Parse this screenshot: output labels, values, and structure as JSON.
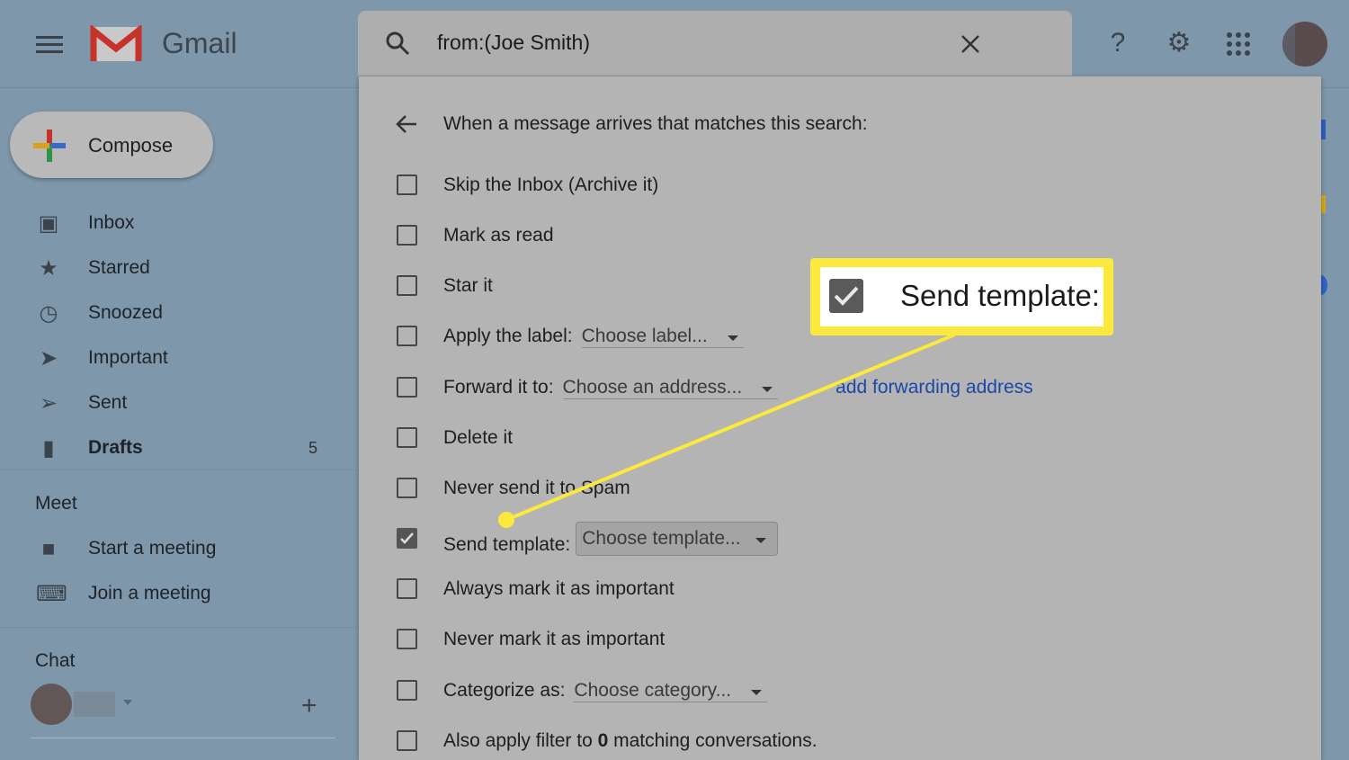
{
  "header": {
    "app_name": "Gmail",
    "search_query": "from:(Joe Smith)"
  },
  "sidebar": {
    "compose_label": "Compose",
    "items": [
      {
        "label": "Inbox",
        "icon": "inbox-icon"
      },
      {
        "label": "Starred",
        "icon": "star-icon"
      },
      {
        "label": "Snoozed",
        "icon": "clock-icon"
      },
      {
        "label": "Important",
        "icon": "important-icon"
      },
      {
        "label": "Sent",
        "icon": "send-icon"
      },
      {
        "label": "Drafts",
        "icon": "draft-icon",
        "count": "5"
      }
    ],
    "meet": {
      "title": "Meet",
      "items": [
        {
          "label": "Start a meeting"
        },
        {
          "label": "Join a meeting"
        }
      ]
    },
    "chat": {
      "title": "Chat"
    }
  },
  "filter": {
    "heading": "When a message arrives that matches this search:",
    "options": [
      {
        "label": "Skip the Inbox (Archive it)",
        "checked": false
      },
      {
        "label": "Mark as read",
        "checked": false
      },
      {
        "label": "Star it",
        "checked": false
      },
      {
        "label": "Apply the label:",
        "select": "Choose label...",
        "checked": false
      },
      {
        "label": "Forward it to:",
        "select": "Choose an address...",
        "link": "add forwarding address",
        "checked": false
      },
      {
        "label": "Delete it",
        "checked": false
      },
      {
        "label": "Never send it to Spam",
        "checked": false
      },
      {
        "label": "Send template:",
        "select": "Choose template...",
        "checked": true
      },
      {
        "label": "Always mark it as important",
        "checked": false
      },
      {
        "label": "Never mark it as important",
        "checked": false
      },
      {
        "label": "Categorize as:",
        "select": "Choose category...",
        "checked": false
      },
      {
        "label_pre": "Also apply filter to ",
        "label_bold": "0",
        "label_post": " matching conversations.",
        "checked": false
      }
    ]
  },
  "callout": {
    "text": "Send template:",
    "color": "#fbe93c"
  }
}
